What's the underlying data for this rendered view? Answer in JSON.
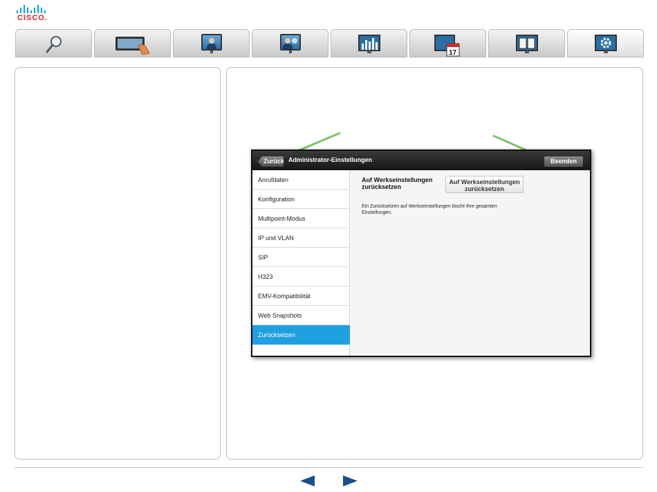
{
  "brand": {
    "logo_text": "CISCO.",
    "logo_color": "#d6242b",
    "bars_color": "#049fd9"
  },
  "top_tabs": [
    {
      "name": "search",
      "icon": "magnifier-icon"
    },
    {
      "name": "touch",
      "icon": "touch-controller-icon"
    },
    {
      "name": "video-call",
      "icon": "video-monitor-icon"
    },
    {
      "name": "share",
      "icon": "presentation-monitor-icon"
    },
    {
      "name": "stats",
      "icon": "bar-chart-monitor-icon"
    },
    {
      "name": "calendar",
      "icon": "calendar-monitor-icon",
      "badge": "17"
    },
    {
      "name": "book",
      "icon": "manual-monitor-icon"
    },
    {
      "name": "settings",
      "icon": "gear-monitor-icon",
      "active": true
    }
  ],
  "device": {
    "back_label": "Zurück",
    "title": "Administrator-Einstellungen",
    "end_label": "Beenden",
    "menu": [
      "Anrufdaten",
      "Konfiguration",
      "Multipoint-Modus",
      "IP und VLAN",
      "SIP",
      "H323",
      "EMV-Kompatibilität",
      "Web Snapshots",
      "Zurücksetzen"
    ],
    "active_index": 8,
    "content": {
      "title": "Auf Werkseinstellungen zurücksetzen",
      "button_label": "Auf Werkseinstellungen zurücksetzen",
      "description": "Ein Zurücksetzen auf Werkseinstellungen löscht Ihre gesamten Einstellungen."
    }
  },
  "colors": {
    "accent": "#1fa0e0",
    "arrow": "#7cc36a"
  }
}
